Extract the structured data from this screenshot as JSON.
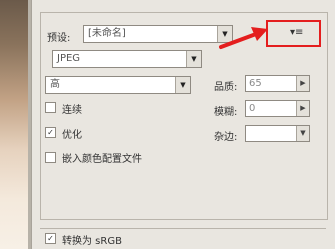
{
  "preset": {
    "label": "预设:",
    "value": "[未命名]"
  },
  "format": {
    "value": "JPEG"
  },
  "quality_preset": {
    "value": "高"
  },
  "quality": {
    "label": "品质:",
    "value": "65"
  },
  "blur": {
    "label": "模糊:",
    "value": "0"
  },
  "matte": {
    "label": "杂边:",
    "value": ""
  },
  "options": [
    {
      "label": "连续",
      "checked": false
    },
    {
      "label": "优化",
      "checked": true
    },
    {
      "label": "嵌入颜色配置文件",
      "checked": false
    }
  ],
  "convert": {
    "label": "转换为 sRGB",
    "checked": true
  },
  "menu_button": {
    "glyph": "▾≡"
  },
  "colors": {
    "highlight": "#e41e1e",
    "arrow": "#e41e1e"
  }
}
